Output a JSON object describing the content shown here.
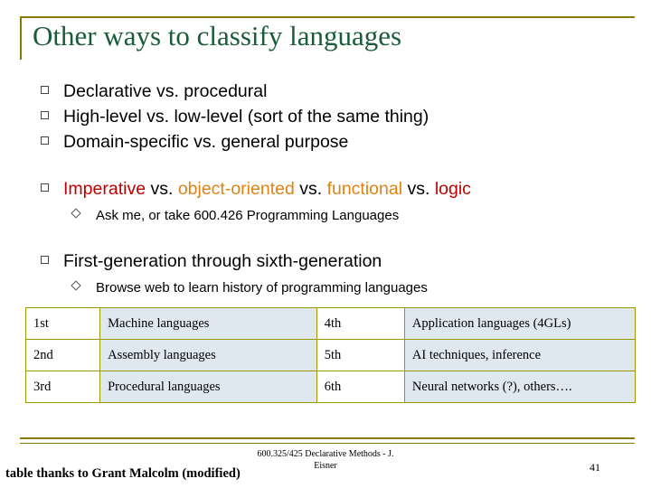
{
  "slide": {
    "title": "Other ways to classify languages",
    "bullets": [
      {
        "segments": [
          {
            "text": "Declarative vs. procedural",
            "color": "black"
          }
        ]
      },
      {
        "segments": [
          {
            "text": "High-level vs. low-level  (sort of the same thing)",
            "color": "black"
          }
        ]
      },
      {
        "segments": [
          {
            "text": "Domain-specific vs. general purpose",
            "color": "black"
          }
        ]
      },
      {
        "segments": [
          {
            "text": "Imperative",
            "color": "red"
          },
          {
            "text": " vs. ",
            "color": "black"
          },
          {
            "text": "object-oriented",
            "color": "orange"
          },
          {
            "text": " vs. ",
            "color": "black"
          },
          {
            "text": "functional",
            "color": "orange"
          },
          {
            "text": " vs. ",
            "color": "black"
          },
          {
            "text": "logic",
            "color": "red"
          }
        ],
        "sub": "Ask me, or take 600.426 Programming Languages"
      },
      {
        "segments": [
          {
            "text": "First-generation through sixth-generation",
            "color": "black"
          }
        ],
        "sub": "Browse web to learn history of programming languages"
      }
    ],
    "table": {
      "rows": [
        {
          "left_num": "1st",
          "left_name": "Machine languages",
          "right_num": "4th",
          "right_name": "Application languages (4GLs)"
        },
        {
          "left_num": "2nd",
          "left_name": "Assembly languages",
          "right_num": "5th",
          "right_name": "AI techniques, inference"
        },
        {
          "left_num": "3rd",
          "left_name": "Procedural languages",
          "right_num": "6th",
          "right_name": "Neural networks (?), others…."
        }
      ]
    },
    "footer": {
      "course_line1": "600.325/425 Declarative Methods - J.",
      "course_line2": "Eisner",
      "page_number": "41",
      "credit": "table thanks to Grant Malcolm (modified)"
    },
    "colors": {
      "title": "#1a5c3a",
      "rule": "#8a7a00",
      "cell_fill": "#dfe7ef",
      "red": "#c00000",
      "orange": "#e08214"
    }
  }
}
